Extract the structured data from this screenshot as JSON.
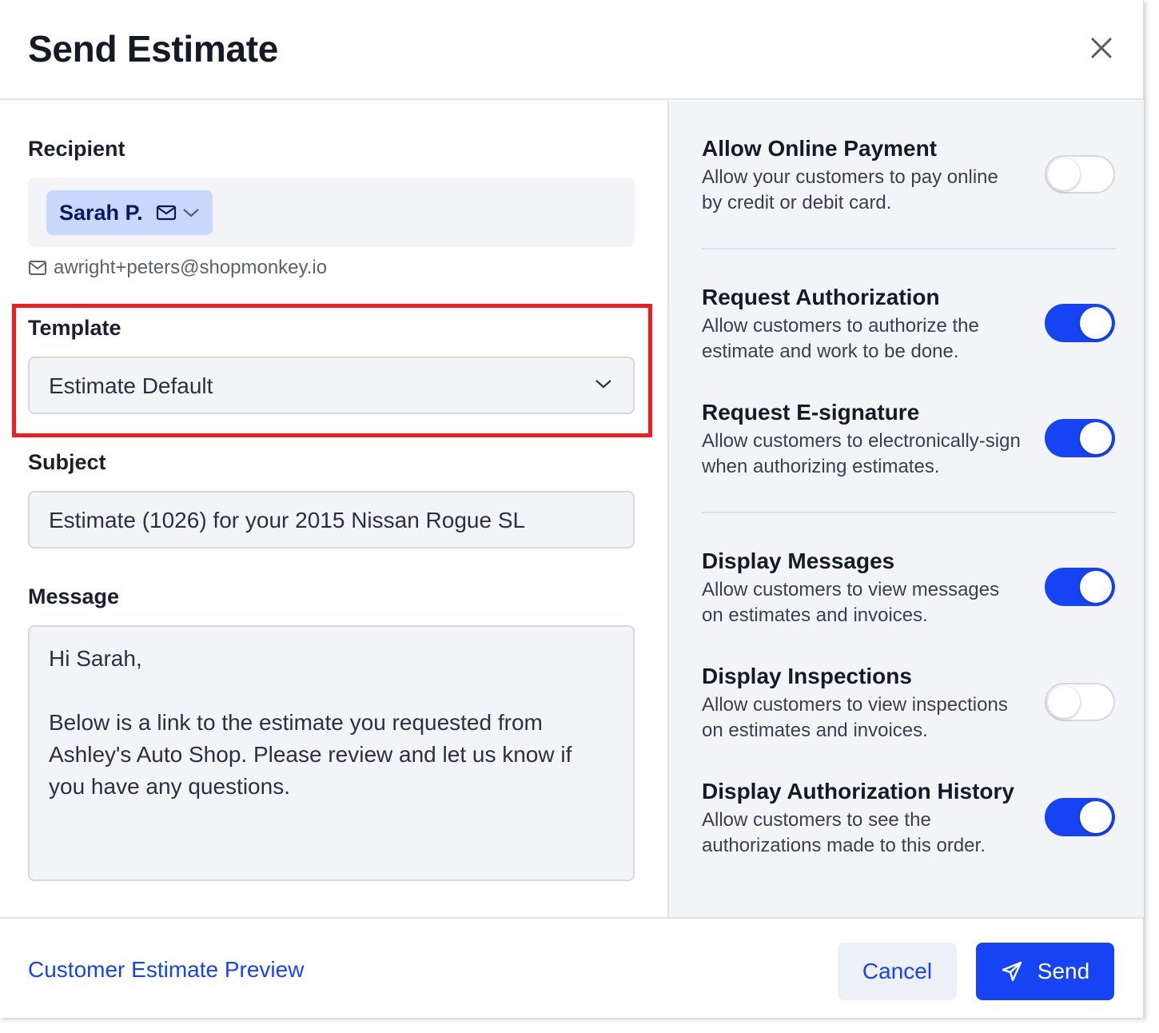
{
  "dialog": {
    "title": "Send Estimate",
    "close_icon": "close-icon"
  },
  "recipient": {
    "label": "Recipient",
    "chip_name": "Sarah P.",
    "email": "awright+peters@shopmonkey.io"
  },
  "template": {
    "label": "Template",
    "selected": "Estimate Default"
  },
  "subject": {
    "label": "Subject",
    "value": "Estimate (1026) for your 2015 Nissan Rogue SL"
  },
  "message": {
    "label": "Message",
    "greeting": "Hi Sarah,",
    "body": "Below is a link to the estimate you requested from Ashley's Auto Shop. Please review and let us know if you have any questions."
  },
  "settings": [
    {
      "title": "Allow Online Payment",
      "description": "Allow your customers to pay online by credit or debit card.",
      "enabled": false
    },
    {
      "title": "Request Authorization",
      "description": "Allow customers to authorize the estimate and work to be done.",
      "enabled": true
    },
    {
      "title": "Request E-signature",
      "description": "Allow customers to electronically-sign when authorizing estimates.",
      "enabled": true
    },
    {
      "title": "Display Messages",
      "description": "Allow customers to view messages on estimates and invoices.",
      "enabled": true
    },
    {
      "title": "Display Inspections",
      "description": "Allow customers to view inspections on estimates and invoices.",
      "enabled": false
    },
    {
      "title": "Display Authorization History",
      "description": "Allow customers to see the authorizations made to this order.",
      "enabled": true
    }
  ],
  "footer": {
    "preview_link": "Customer Estimate Preview",
    "cancel_label": "Cancel",
    "send_label": "Send"
  },
  "colors": {
    "accent": "#1644f5",
    "highlight_box": "#ef1c22",
    "chip_bg": "#c9d8ff"
  }
}
